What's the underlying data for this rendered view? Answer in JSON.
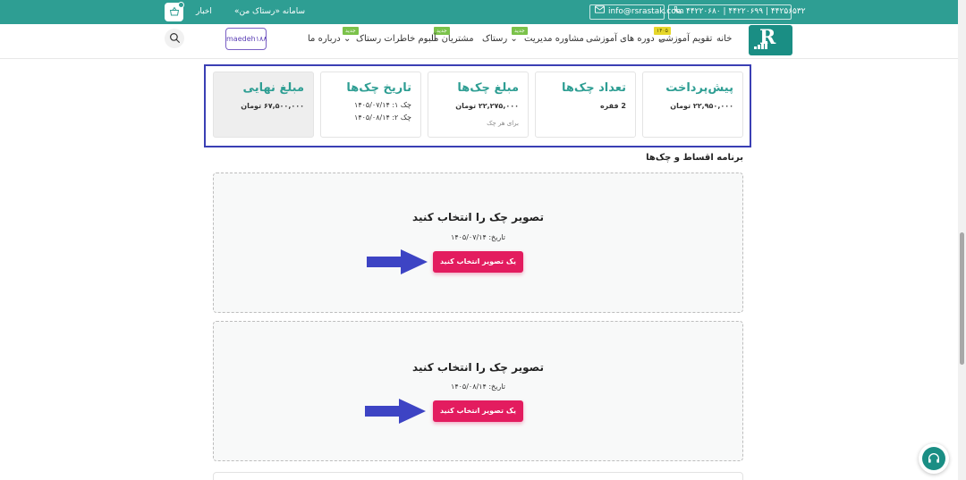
{
  "topbar": {
    "phone": "۴۴۲۲۰۶۸۰ | ۴۴۲۲۰۶۹۹ | ۴۴۲۵۶۵۳۲",
    "email": "info@rsrastak.com",
    "my_system": "سامانه «رستاک من»",
    "news": "اخبار",
    "bg_color": "#2e9e93"
  },
  "nav": {
    "home": "خانه",
    "calendar": "تقویم آموزشی",
    "courses": "دوره های آموزشی",
    "consulting": "مشاوره مدیریت",
    "rastak": "رستاک",
    "clients": "مشتریان ما",
    "album": "آلبوم خاطرات رستاک",
    "about": "درباره ما",
    "badge_new": "جدید",
    "badge_new2": "جدید",
    "badge_new3": "جدید",
    "badge_calendar": "۱۴۰۵",
    "user": "maedeh۱۸۸"
  },
  "summary": {
    "prepayment": {
      "title": "پیش‌پرداخت",
      "value": "۲۲,۹۵۰,۰۰۰ تومان"
    },
    "cheque_count": {
      "title": "تعداد چک‌ها",
      "value": "2 فقره"
    },
    "cheque_amount": {
      "title": "مبلغ چک‌ها",
      "value": "۲۲,۲۷۵,۰۰۰ تومان",
      "note": "برای هر چک"
    },
    "cheque_dates": {
      "title": "تاریخ چک‌ها",
      "date1": "چک ۱: ۱۴۰۵/۰۷/۱۴",
      "date2": "چک ۲: ۱۴۰۵/۰۸/۱۴"
    },
    "final_amount": {
      "title": "مبلغ نهایی",
      "value": "۶۷,۵۰۰,۰۰۰ تومان"
    }
  },
  "section_title": "برنامه اقساط و چک‌ها",
  "uploads": [
    {
      "title": "تصویر چک را انتخاب کنید",
      "date": "تاریخ: ۱۴۰۵/۰۷/۱۴",
      "button": "یک تصویر انتخاب کنید"
    },
    {
      "title": "تصویر چک را انتخاب کنید",
      "date": "تاریخ: ۱۴۰۵/۰۸/۱۴",
      "button": "یک تصویر انتخاب کنید"
    }
  ],
  "colors": {
    "primary": "#2e9e93",
    "accent_button": "#e31c5f",
    "arrow": "#3d44c4",
    "frame": "#3a3fb4"
  },
  "icons": {
    "phone": "phone-icon",
    "email": "envelope-icon",
    "basket": "basket-icon",
    "search": "search-icon",
    "support": "headset-icon",
    "arrow": "arrow-right-icon"
  }
}
